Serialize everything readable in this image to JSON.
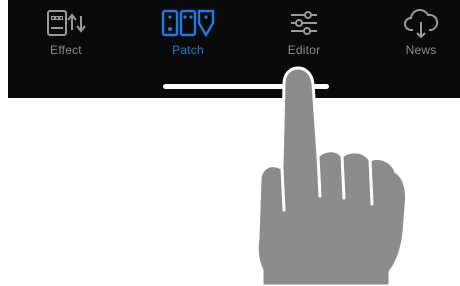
{
  "tabs": [
    {
      "label": "Effect",
      "icon": "effect-icon",
      "active": false
    },
    {
      "label": "Patch",
      "icon": "patch-icon",
      "active": true
    },
    {
      "label": "Editor",
      "icon": "editor-sliders-icon",
      "active": false
    },
    {
      "label": "News",
      "icon": "cloud-download-icon",
      "active": false
    }
  ],
  "colors": {
    "tabbar_bg": "#0a0a0a",
    "active": "#1f7ae6",
    "inactive": "#8a8a8a",
    "hand": "#8c8c8c"
  }
}
